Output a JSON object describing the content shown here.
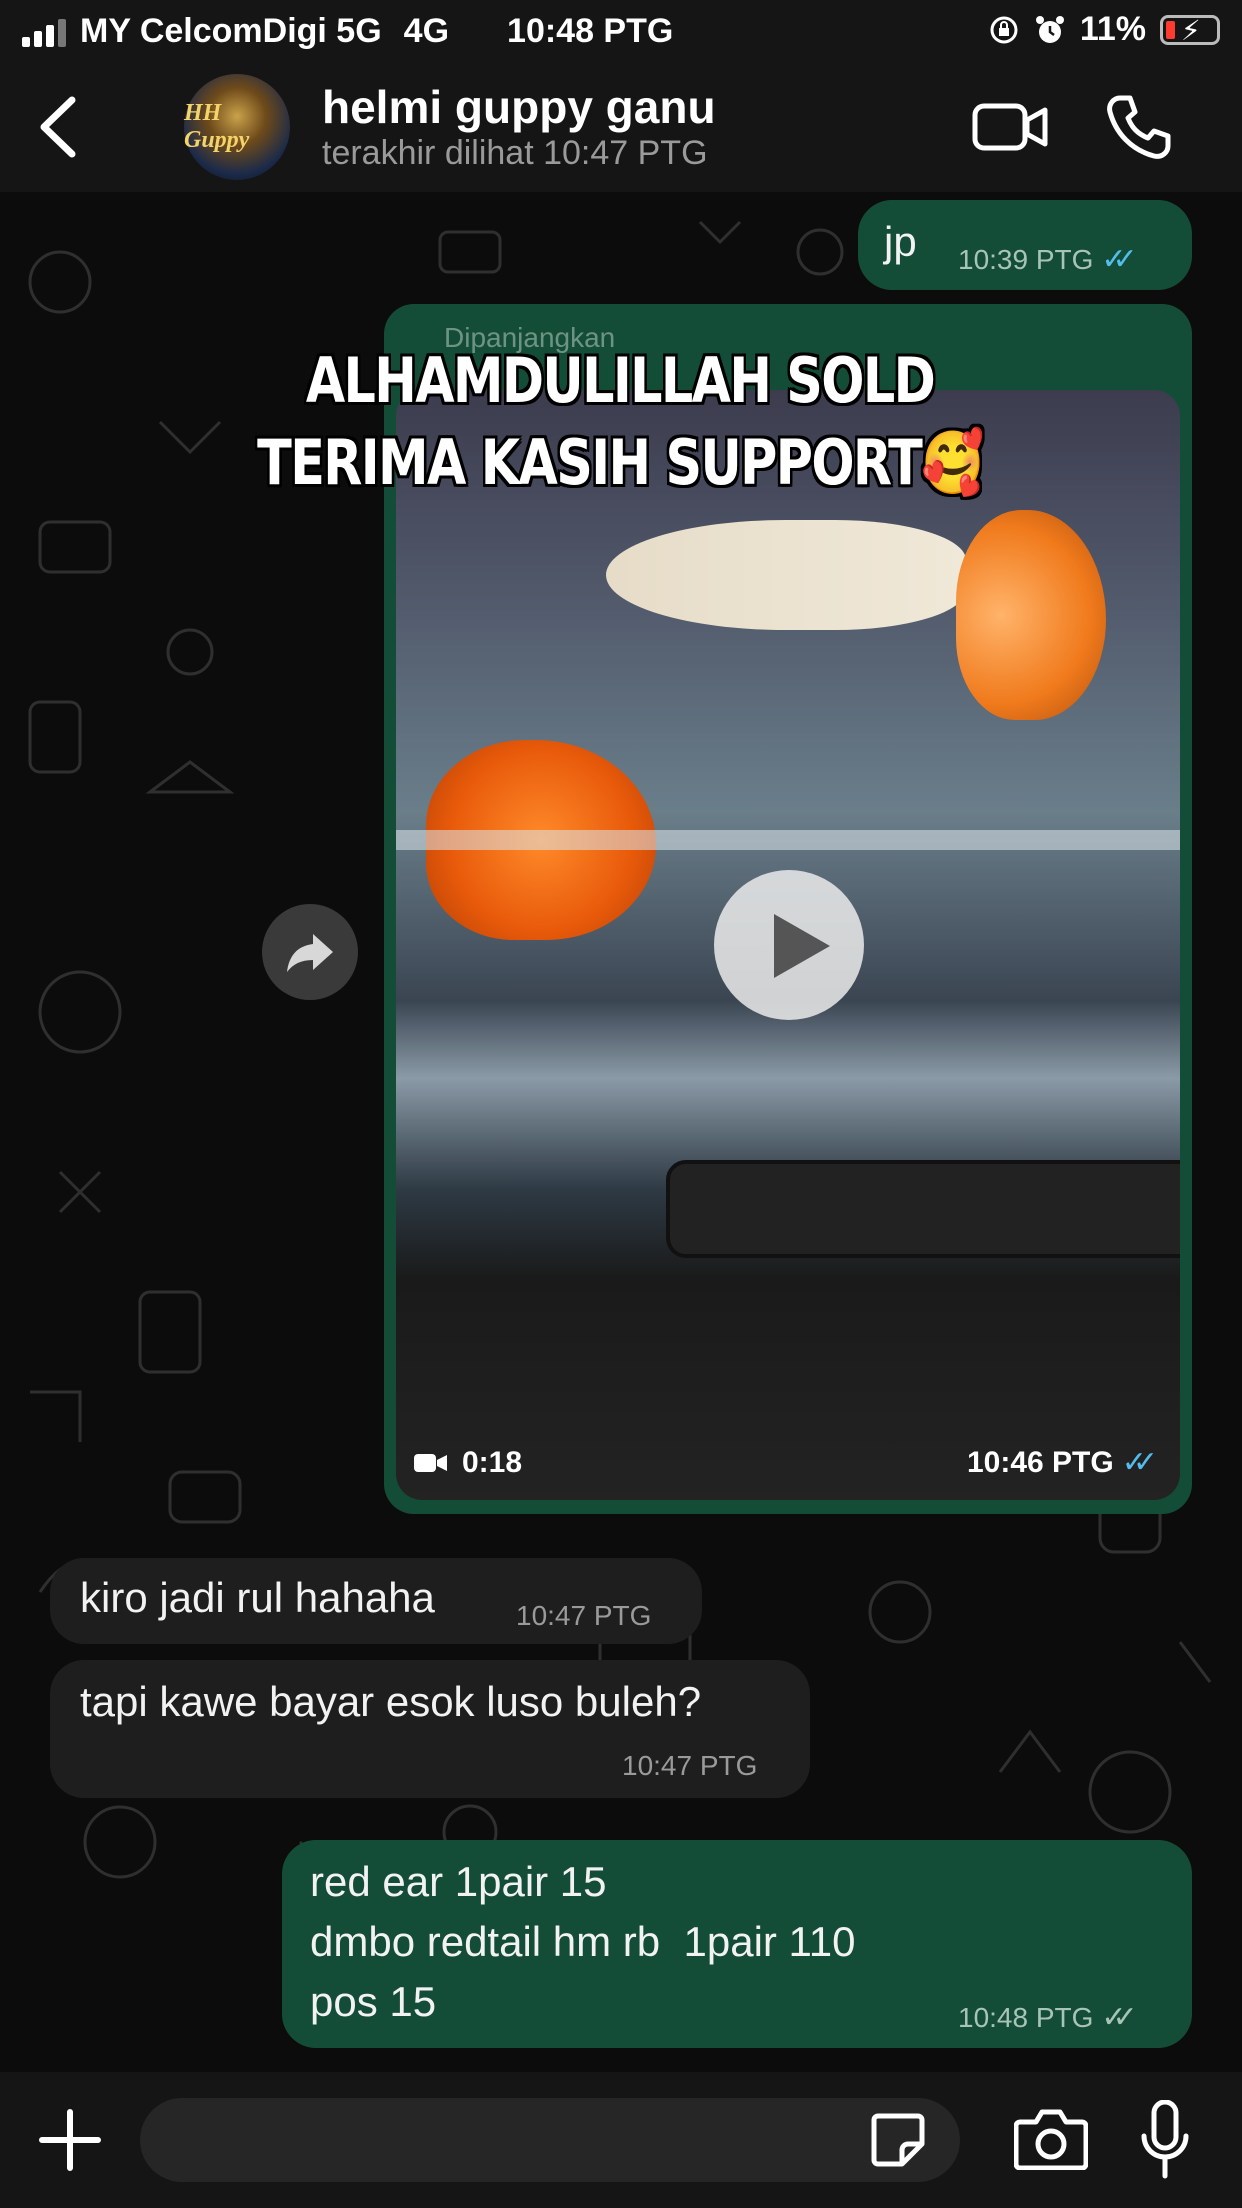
{
  "status_bar": {
    "carrier": "MY CelcomDigi 5G",
    "network": "4G",
    "time": "10:48 PTG",
    "battery_percent": "11%",
    "icons": [
      "signal-icon",
      "orientation-lock-icon",
      "alarm-icon",
      "battery-charging-icon"
    ]
  },
  "header": {
    "contact_name": "helmi guppy ganu",
    "last_seen": "terakhir dilihat 10:47 PTG",
    "avatar_text": "HH Guppy",
    "icons": [
      "back-icon",
      "video-call-icon",
      "voice-call-icon"
    ]
  },
  "messages": [
    {
      "direction": "out",
      "text": "jp",
      "time": "10:39 PTG",
      "status": "read"
    },
    {
      "direction": "out",
      "type": "video",
      "forwarded_label": "Dipanjangkan",
      "caption_overlay": "ALHAMDULILLAH SOLD TERIMA KASIH SUPPORT🥰",
      "duration": "0:18",
      "time": "10:46 PTG",
      "status": "read"
    },
    {
      "direction": "in",
      "text": "kiro jadi rul hahaha",
      "time": "10:47 PTG"
    },
    {
      "direction": "in",
      "text": "tapi kawe bayar esok luso buleh?",
      "time": "10:47 PTG"
    },
    {
      "direction": "out",
      "lines": [
        "red ear 1pair 15",
        "dmbo redtail hm rb  1pair 110",
        "pos 15"
      ],
      "time": "10:48 PTG",
      "status": "delivered"
    }
  ],
  "input_bar": {
    "placeholder": "",
    "icons": [
      "plus-icon",
      "sticker-icon",
      "camera-icon",
      "microphone-icon"
    ]
  },
  "colors": {
    "outgoing_bubble": "#144d37",
    "incoming_bubble": "#1e1e1e",
    "read_ticks": "#53bdeb",
    "background": "#0c0c0c"
  }
}
